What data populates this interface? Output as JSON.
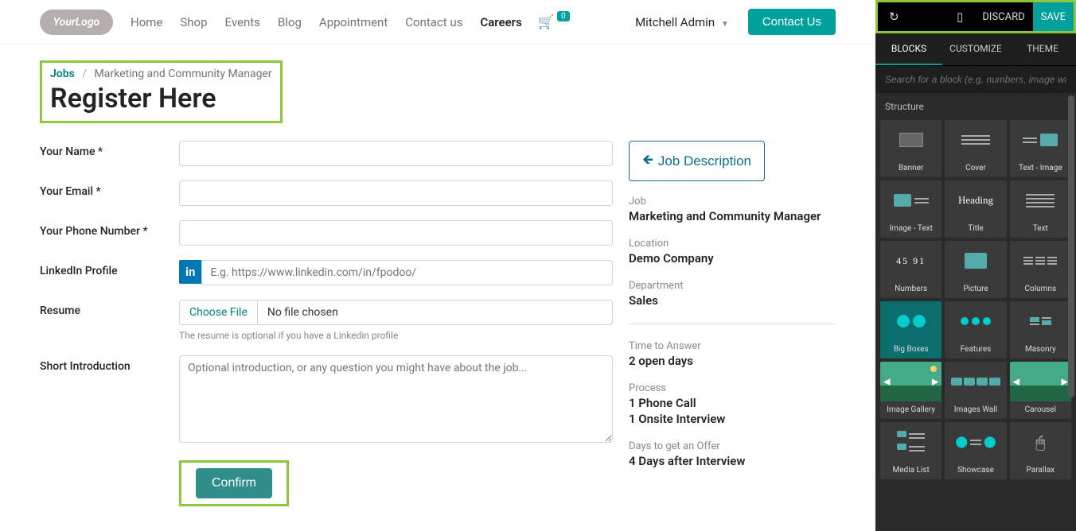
{
  "header": {
    "logo_text": "YourLogo",
    "nav": [
      "Home",
      "Shop",
      "Events",
      "Blog",
      "Appointment",
      "Contact us",
      "Careers"
    ],
    "nav_active_index": 6,
    "cart_count": "0",
    "user": "Mitchell Admin",
    "contact_btn": "Contact Us"
  },
  "breadcrumb": {
    "root": "Jobs",
    "current": "Marketing and Community Manager"
  },
  "page_title": "Register Here",
  "form": {
    "name_label": "Your Name *",
    "email_label": "Your Email *",
    "phone_label": "Your Phone Number *",
    "linkedin_label": "LinkedIn Profile",
    "linkedin_placeholder": "E.g. https://www.linkedin.com/in/fpodoo/",
    "resume_label": "Resume",
    "choose_file": "Choose File",
    "no_file": "No file chosen",
    "resume_help": "The resume is optional if you have a Linkedin profile",
    "intro_label": "Short Introduction",
    "intro_placeholder": "Optional introduction, or any question you might have about the job...",
    "confirm": "Confirm"
  },
  "sidebar": {
    "jd_btn": "Job Description",
    "labels": {
      "job": "Job",
      "location": "Location",
      "department": "Department",
      "tta": "Time to Answer",
      "process": "Process",
      "days_offer": "Days to get an Offer"
    },
    "job": "Marketing and Community Manager",
    "location": "Demo Company",
    "department": "Sales",
    "tta": "2 open days",
    "process1": "1 Phone Call",
    "process2": "1 Onsite Interview",
    "days_offer": "4 Days after Interview"
  },
  "editor": {
    "discard": "DISCARD",
    "save": "SAVE",
    "tabs": [
      "BLOCKS",
      "CUSTOMIZE",
      "THEME"
    ],
    "active_tab": 0,
    "search_placeholder": "Search for a block (e.g. numbers, image wall, ...)",
    "section": "Structure",
    "blocks": [
      "Banner",
      "Cover",
      "Text - Image",
      "Image - Text",
      "Title",
      "Text",
      "Numbers",
      "Picture",
      "Columns",
      "Big Boxes",
      "Features",
      "Masonry",
      "Image Gallery",
      "Images Wall",
      "Carousel",
      "Media List",
      "Showcase",
      "Parallax"
    ]
  }
}
